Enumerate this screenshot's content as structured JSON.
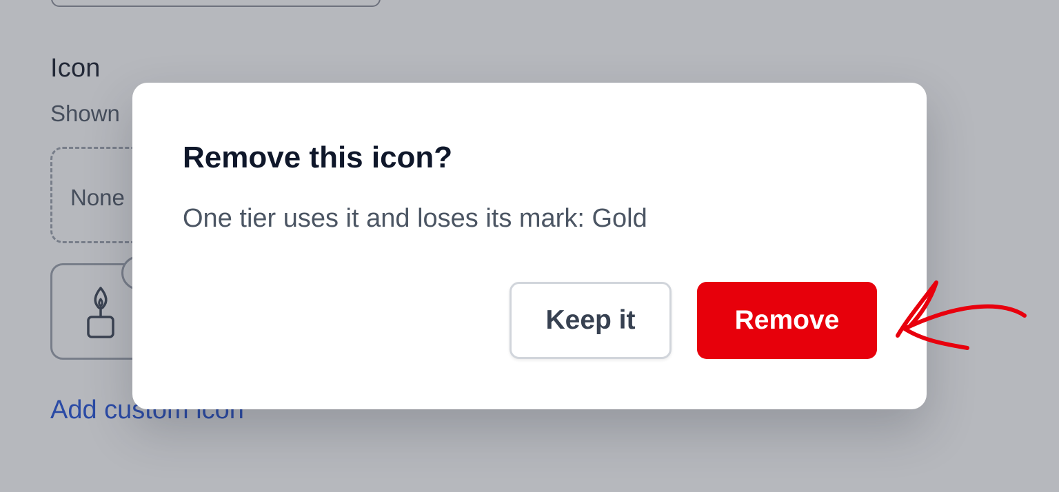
{
  "background": {
    "section_title": "Icon",
    "section_subtitle": "Shown",
    "none_option_label": "None",
    "add_custom_icon_label": "Add custom icon"
  },
  "dialog": {
    "title": "Remove this icon?",
    "message": "One tier uses it and loses its mark: Gold",
    "keep_label": "Keep it",
    "remove_label": "Remove"
  },
  "colors": {
    "danger": "#e7000b",
    "link": "#1d4ed8",
    "annotation": "#e8000d"
  },
  "icons": {
    "tile_icon": "candle-icon",
    "annotation": "arrow-annotation"
  }
}
